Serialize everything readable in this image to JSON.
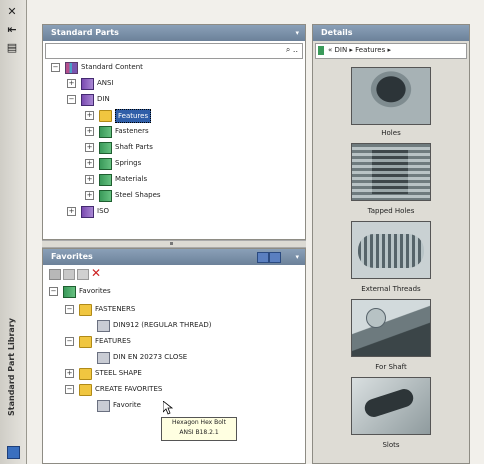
{
  "sidebar": {
    "title": "Standard Part Library",
    "icons": [
      "close-icon",
      "pin-icon",
      "properties-icon"
    ]
  },
  "standard_parts": {
    "title": "Standard Parts",
    "menu_glyph": "▾",
    "search_value": "",
    "search_glyph": "⌕ ..",
    "tree": [
      {
        "label": "Standard Content",
        "expander": "−",
        "icon": "book-multi"
      },
      {
        "label": "ANSI",
        "expander": "+",
        "icon": "book-purple"
      },
      {
        "label": "DIN",
        "expander": "−",
        "icon": "book-purple"
      },
      {
        "label": "Features",
        "expander": "+",
        "icon": "folder",
        "selected": true
      },
      {
        "label": "Fasteners",
        "expander": "+",
        "icon": "book-green"
      },
      {
        "label": "Shaft Parts",
        "expander": "+",
        "icon": "book-green"
      },
      {
        "label": "Springs",
        "expander": "+",
        "icon": "book-green"
      },
      {
        "label": "Materials",
        "expander": "+",
        "icon": "book-green"
      },
      {
        "label": "Steel Shapes",
        "expander": "+",
        "icon": "book-green"
      },
      {
        "label": "ISO",
        "expander": "+",
        "icon": "book-purple"
      }
    ]
  },
  "favorites": {
    "title": "Favorites",
    "menu_glyph": "▾",
    "delete_glyph": "✕",
    "tree": [
      {
        "label": "Favorites",
        "expander": "−",
        "icon": "book-green"
      },
      {
        "label": "FASTENERS",
        "expander": "−",
        "icon": "folder"
      },
      {
        "label": "DIN912 (REGULAR THREAD)",
        "expander": "",
        "icon": "part"
      },
      {
        "label": "FEATURES",
        "expander": "−",
        "icon": "folder"
      },
      {
        "label": "DIN EN 20273 CLOSE",
        "expander": "",
        "icon": "part"
      },
      {
        "label": "STEEL SHAPE",
        "expander": "+",
        "icon": "folder"
      },
      {
        "label": "CREATE FAVORITES",
        "expander": "−",
        "icon": "folder"
      },
      {
        "label": "Favorite",
        "expander": "",
        "icon": "part"
      }
    ],
    "tooltip": [
      "Hexagon Hex Bolt",
      "ANSI B18.2.1"
    ]
  },
  "details": {
    "title": "Details",
    "breadcrumb": "« DIN ▸ Features ▸",
    "items": [
      "Holes",
      "Tapped Holes",
      "External Threads",
      "For Shaft",
      "Slots"
    ]
  },
  "colors": {
    "header": "#7a8fa8",
    "selection": "#2f5ea8",
    "accent_red": "#cc2222"
  }
}
